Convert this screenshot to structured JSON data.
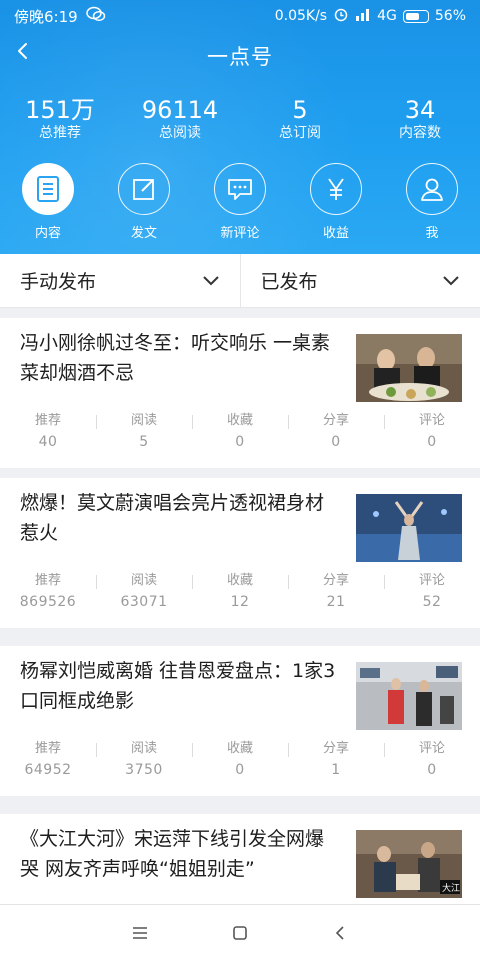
{
  "status": {
    "time": "傍晚6:19",
    "speed": "0.05K/s",
    "network": "4G",
    "battery": "56%"
  },
  "header": {
    "title": "一点号",
    "back_icon": "back-arrow-icon"
  },
  "stats": [
    {
      "value": "151万",
      "label": "总推荐"
    },
    {
      "value": "96114",
      "label": "总阅读"
    },
    {
      "value": "5",
      "label": "总订阅"
    },
    {
      "value": "34",
      "label": "内容数"
    }
  ],
  "nav": [
    {
      "label": "内容",
      "icon": "document-icon",
      "active": true
    },
    {
      "label": "发文",
      "icon": "edit-icon",
      "active": false
    },
    {
      "label": "新评论",
      "icon": "comment-icon",
      "active": false
    },
    {
      "label": "收益",
      "icon": "yen-icon",
      "active": false
    },
    {
      "label": "我",
      "icon": "user-icon",
      "active": false
    }
  ],
  "filters": [
    {
      "label": "手动发布"
    },
    {
      "label": "已发布"
    }
  ],
  "stat_labels": [
    "推荐",
    "阅读",
    "收藏",
    "分享",
    "评论"
  ],
  "articles": [
    {
      "title": "冯小刚徐帆过冬至：听交响乐 一桌素菜却烟酒不忌",
      "stats": [
        "40",
        "5",
        "0",
        "0",
        "0"
      ]
    },
    {
      "title": "燃爆！莫文蔚演唱会亮片透视裙身材惹火",
      "stats": [
        "869526",
        "63071",
        "12",
        "21",
        "52"
      ]
    },
    {
      "title": "杨幂刘恺威离婚 往昔恩爱盘点：1家3口同框成绝影",
      "stats": [
        "64952",
        "3750",
        "0",
        "1",
        "0"
      ]
    },
    {
      "title": "《大江大河》宋运萍下线引发全网爆哭 网友齐声呼唤“姐姐别走”",
      "stats": [
        "",
        "",
        "",
        "",
        ""
      ]
    }
  ],
  "colors": {
    "header_blue": "#1f9ff0",
    "active_icon": "#1f9ff0",
    "text_gray": "#9a9a9a"
  }
}
